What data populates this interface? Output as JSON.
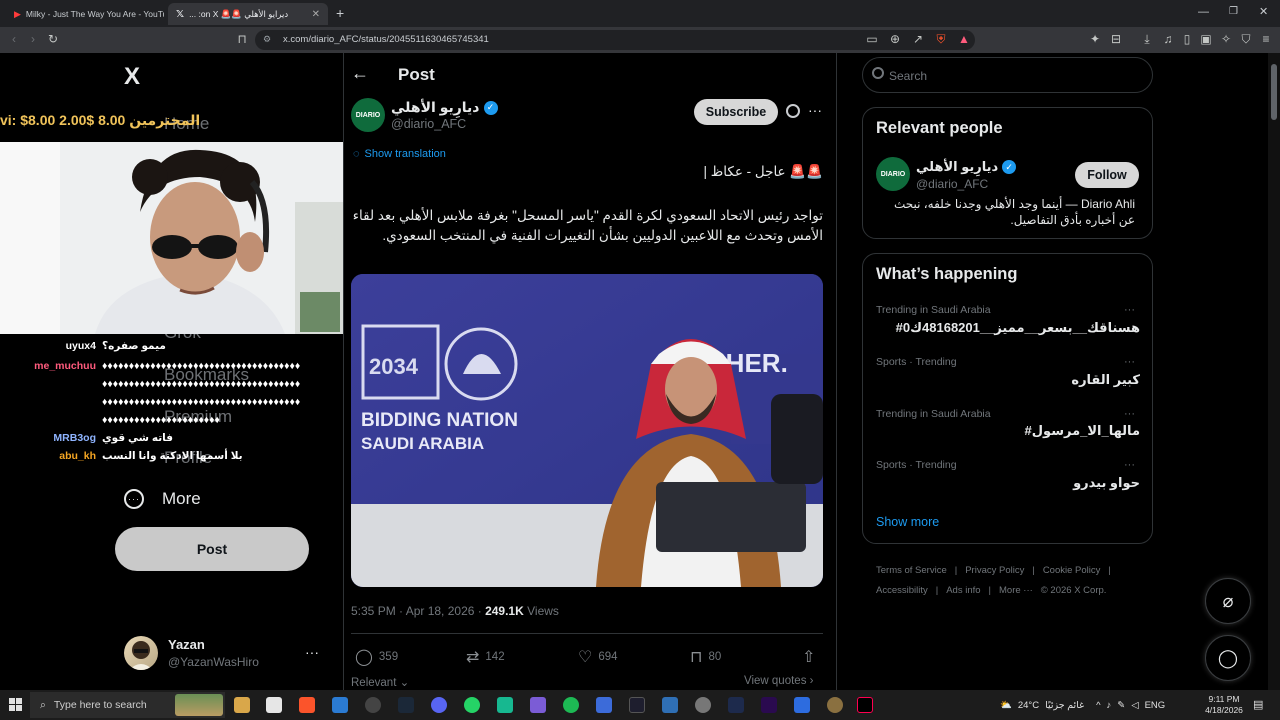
{
  "browser": {
    "tabs": [
      {
        "title": "Milky - Just The Way You Are - YouTu",
        "active": false
      },
      {
        "title": "ديرايو الأهلي 🚨🚨 on X: ...",
        "active": true
      }
    ],
    "new_tab": "+",
    "url": "x.com/diario_AFC/status/2045511630465745341"
  },
  "nav": {
    "logo": "X",
    "ghost_items": [
      "Home",
      "Grok",
      "Bookmarks",
      "Premium",
      "Profile"
    ],
    "more_label": "More",
    "post_label": "Post",
    "account": {
      "name": "Yazan",
      "handle": "@YazanWasHiro"
    }
  },
  "stream": {
    "ticker": "vi: $8.00   2.00$ المحترمين   8.00",
    "chat": [
      {
        "user": "uyux4",
        "color": "#ffffff",
        "msg": "ميمو صفره؟"
      },
      {
        "user": "me_muchuu",
        "color": "#ff5b7d",
        "msg": "♦♦♦♦♦♦♦♦♦♦♦♦♦♦♦♦♦♦♦♦♦♦♦♦♦♦♦♦♦♦♦♦♦♦♦♦♦"
      },
      {
        "user": "",
        "color": "#ffffff",
        "msg": "♦♦♦♦♦♦♦♦♦♦♦♦♦♦♦♦♦♦♦♦♦♦♦♦♦♦♦♦♦♦♦♦♦♦♦♦♦"
      },
      {
        "user": "",
        "color": "#ffffff",
        "msg": "♦♦♦♦♦♦♦♦♦♦♦♦♦♦♦♦♦♦♦♦♦♦♦♦♦♦♦♦♦♦♦♦♦♦♦♦♦"
      },
      {
        "user": "",
        "color": "#ffffff",
        "msg": "♦♦♦♦♦♦♦♦♦♦♦♦♦♦♦♦♦♦♦♦♦♦"
      },
      {
        "user": "MRB3og",
        "color": "#8fb4ff",
        "msg": "فاته شي قوي"
      },
      {
        "user": "abu_kh",
        "color": "#f5a623",
        "msg": "بلا أسمها الادكتة وانا النسب"
      }
    ]
  },
  "post": {
    "header_title": "Post",
    "author": {
      "name": "ديارِيو الأهلي",
      "handle": "@diario_AFC",
      "avatar_text": "DIARIO"
    },
    "subscribe_label": "Subscribe",
    "show_translation": "Show translation",
    "headline": "🚨🚨 عاجل - عكاظ |",
    "body": "تواجد رئيس الاتحاد السعودي لكرة القدم \"ياسر المسحل\" بغرفة ملابس الأهلي بعد لقاء الأمس وتحدث مع اللاعبين الدوليين بشأن التغييرات الفنية في المنتخب السعودي.",
    "image": {
      "logo_text": "2034",
      "bidding_line1": "BIDDING NATION",
      "bidding_line2": "SAUDI ARABIA",
      "bg_text": "G. HER."
    },
    "time": "5:35 PM · Apr 18, 2026 · ",
    "views_count": "249.1K",
    "views_label": " Views",
    "metrics": {
      "replies": "359",
      "reposts": "142",
      "likes": "694",
      "bookmarks": "80"
    },
    "relevant": "Relevant ⌄",
    "view_quotes": "View quotes ›"
  },
  "sidebar": {
    "search_placeholder": "Search",
    "relevant_people_title": "Relevant people",
    "person": {
      "name": "ديارِيو الأهلي",
      "handle": "@diario_AFC",
      "follow_label": "Follow",
      "bio": "Diario Ahli — أينما وجد الأهلي وجدنا خلفه، نبحث عن أخباره بأدق التفاصيل."
    },
    "whats_happening_title": "What’s happening",
    "trends": [
      {
        "context": "Trending in Saudi Arabia",
        "name": "#هسناقك__بسعر__مميز__48168201ك0"
      },
      {
        "context": "Sports · Trending",
        "name": "كبير القاره"
      },
      {
        "context": "Trending in Saudi Arabia",
        "name": "#مالها_الا_مرسول"
      },
      {
        "context": "Sports · Trending",
        "name": "حواو بيدرو"
      }
    ],
    "show_more": "Show more",
    "footer": [
      "Terms of Service",
      "|",
      "Privacy Policy",
      "|",
      "Cookie Policy",
      "|",
      "Accessibility",
      "|",
      "Ads info",
      "|",
      "More ···",
      "© 2026 X Corp."
    ]
  },
  "taskbar": {
    "search_placeholder": "Type here to search",
    "weather": "24°C",
    "weather_label": "غائم جزئيًا",
    "lang": "ENG",
    "time": "9:11 PM",
    "date": "4/18/2026"
  }
}
